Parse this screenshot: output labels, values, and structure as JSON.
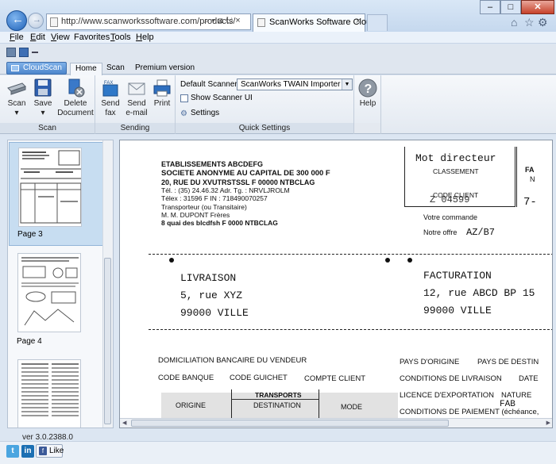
{
  "browser": {
    "url": "http://www.scanworkssoftware.com/products/",
    "address_controls": "⌕ ▾ ⊠ ↻ ×",
    "tab_title": "ScanWorks Software Cloud...",
    "tab_close": "×",
    "back_arrow": "←",
    "forward_arrow": "→",
    "window_buttons": {
      "minimize": "–",
      "maximize": "□",
      "close": "✕"
    },
    "toolbar_icons": [
      "home-icon",
      "favorites-star-icon",
      "settings-gear-icon"
    ],
    "tool_glyphs": [
      "⌂",
      "☆",
      "⚙"
    ]
  },
  "menu": {
    "items": [
      {
        "u": "F",
        "rest": "ile"
      },
      {
        "u": "E",
        "rest": "dit"
      },
      {
        "u": "V",
        "rest": "iew"
      },
      {
        "u": "",
        "rest": "Favorites"
      },
      {
        "u": "T",
        "rest": "ools"
      },
      {
        "u": "H",
        "rest": "elp"
      }
    ]
  },
  "ribbon": {
    "app_tab": "CloudScan",
    "tabs": [
      "Home",
      "Scan",
      "Premium version"
    ],
    "active_tab": "Home",
    "groups": {
      "scan": {
        "label": "Scan",
        "buttons": [
          {
            "label": "Scan",
            "sub": "▾"
          },
          {
            "label": "Save",
            "sub": "▾"
          },
          {
            "label": "Delete",
            "sub": "Document"
          }
        ]
      },
      "sending": {
        "label": "Sending",
        "buttons": [
          {
            "label": "Send",
            "sub": "fax",
            "badge": "FAX"
          },
          {
            "label": "Send",
            "sub": "e-mail"
          },
          {
            "label": "Print",
            "sub": ""
          }
        ]
      },
      "quick_settings": {
        "label": "Quick Settings",
        "default_scanner_label": "Default Scanner:",
        "default_scanner_value": "ScanWorks TWAIN Importer",
        "dropdown_arrow": "▼",
        "show_scanner_ui_label": "Show Scanner UI",
        "show_scanner_ui_checked": false,
        "settings_label": "Settings",
        "settings_glyph": "⚙"
      },
      "help": {
        "label": "Help",
        "glyph": "?"
      }
    }
  },
  "thumbnails": [
    {
      "label": "Page 3",
      "selected": true
    },
    {
      "label": "Page 4",
      "selected": false
    },
    {
      "label": "",
      "selected": false
    }
  ],
  "document": {
    "sender": [
      "ETABLISSEMENTS ABCDEFG",
      "SOCIETE ANONYME AU CAPITAL DE 300 000 F",
      "20, RUE DU XVUTRSTSSL F 00000 NTBCLAG",
      "Tél. : (35) 24.46.32 Adr. Tg. : NRVLJROLM",
      "Télex : 31596 F IN : 718490070257",
      "Transporteur (ou Transitaire)",
      "M. M. DUPONT Frères",
      "8 quai des blcdfsh F 0000 NTBCLAG"
    ],
    "box_header": "Mot directeur",
    "classement": "CLASSEMENT",
    "code_client": "CODE CLIENT",
    "code_client_value": "Z 04599",
    "box_right_top": "FA",
    "box_right_mid": "N",
    "right_number": "7-",
    "votre_commande": "Votre commande",
    "notre_offre": "Notre offre",
    "notre_offre_value": "AZ/B7",
    "livraison_title": "LIVRAISON",
    "livraison_lines": [
      "5, rue XYZ",
      "99000 VILLE"
    ],
    "facturation_title": "FACTURATION",
    "facturation_lines": [
      "12, rue ABCD BP 15",
      "99000 VILLE"
    ],
    "domiciliation": "DOMICILIATION BANCAIRE DU VENDEUR",
    "pays_origine": "PAYS D'ORIGINE",
    "pays_destination": "PAYS DE DESTIN",
    "code_banque": "CODE BANQUE",
    "code_guichet": "CODE GUICHET",
    "compte_client": "COMPTE CLIENT",
    "conditions_livraison": "CONDITIONS DE LIVRAISON",
    "date": "DATE",
    "transports": "TRANSPORTS",
    "licence_export": "LICENCE D'EXPORTATION",
    "nature": "NATURE",
    "origine": "ORIGINE",
    "destination": "DESTINATION",
    "mode": "MODE",
    "fab": "FAB",
    "conditions_paiement": "CONDITIONS DE PAIEMENT (échéance,"
  },
  "status": {
    "version": "ver 3.0.2388.0"
  },
  "social": {
    "twitter": "t",
    "linkedin": "in",
    "facebook": "f",
    "like_label": "Like"
  }
}
